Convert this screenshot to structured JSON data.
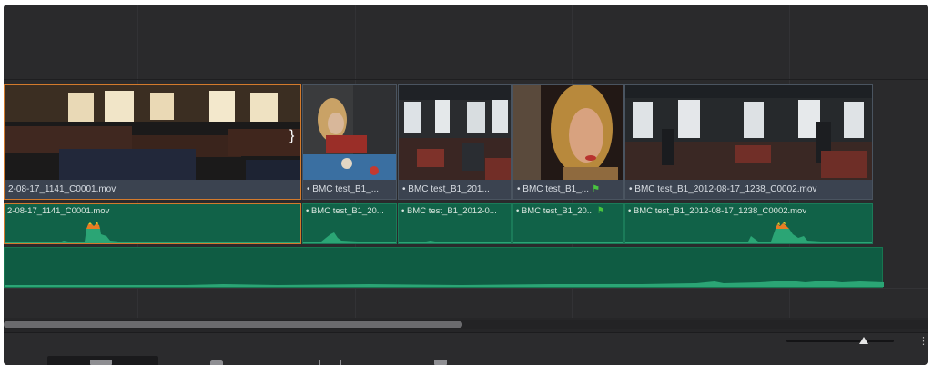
{
  "timeline": {
    "video_clips": [
      {
        "name": "2-08-17_1141_C0001.mov",
        "selected": true
      },
      {
        "name": "BMC test_B1_...",
        "selected": false
      },
      {
        "name": "BMC test_B1_201...",
        "selected": false
      },
      {
        "name": "BMC test_B1_...",
        "selected": false,
        "flag": "green-flag-icon"
      },
      {
        "name": "BMC test_B1_2012-08-17_1238_C0002.mov",
        "selected": false
      }
    ],
    "audio_clips": [
      {
        "name": "2-08-17_1141_C0001.mov",
        "selected": true
      },
      {
        "name": "BMC test_B1_20...",
        "selected": false
      },
      {
        "name": "BMC test_B1_2012-0...",
        "selected": false
      },
      {
        "name": "BMC test_B1_20...",
        "selected": false,
        "flag": "green-flag-icon"
      },
      {
        "name": "BMC test_B1_2012-08-17_1238_C0002.mov",
        "selected": false
      }
    ],
    "music_track": {
      "name": ""
    },
    "colors": {
      "background": "#2a2a2c",
      "video_label": "#3b4350",
      "audio_fill": "#116248",
      "selection": "#d37a2c",
      "flag": "#49c33f"
    }
  },
  "bottom_bar": {
    "zoom_level": 0.72,
    "tools": [
      "timeline-view-icon",
      "effects-icon",
      "transitions-icon",
      "generators-icon"
    ]
  }
}
